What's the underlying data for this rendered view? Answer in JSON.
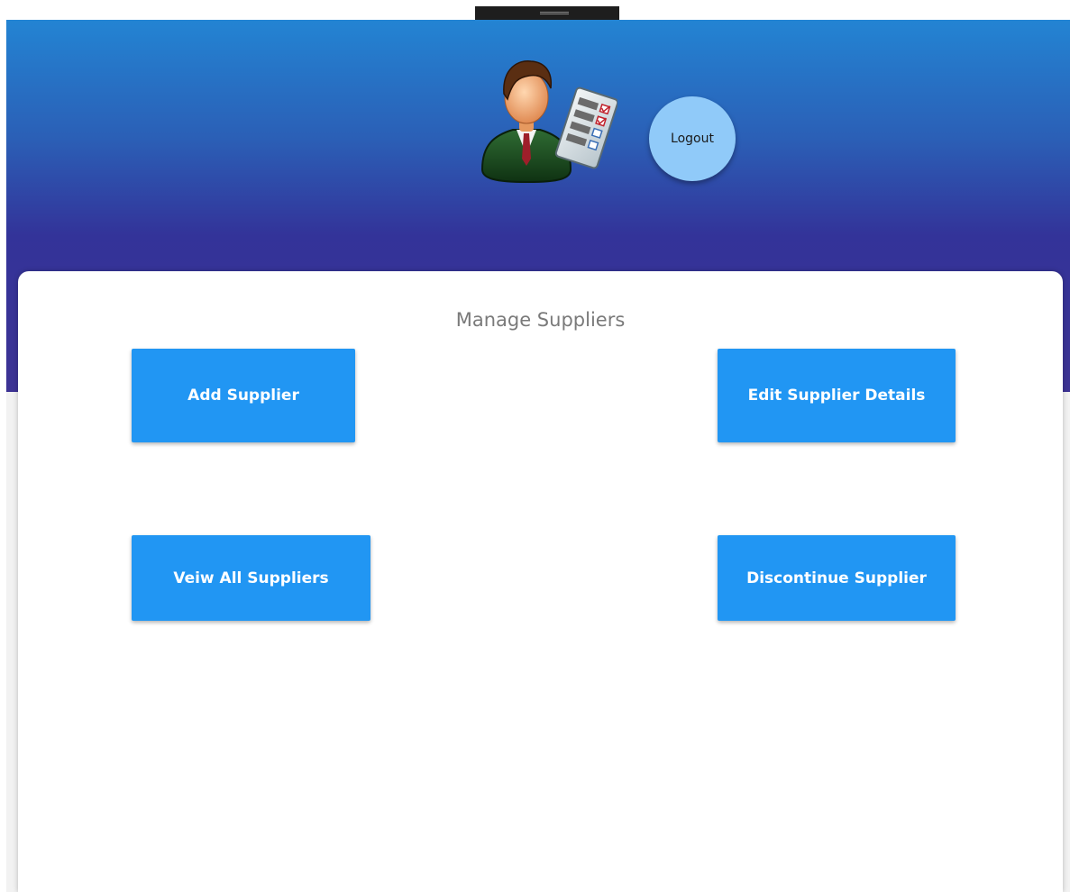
{
  "header": {
    "logout_label": "Logout"
  },
  "main": {
    "title": "Manage Suppliers",
    "buttons": {
      "add": "Add Supplier",
      "edit": "Edit Supplier Details",
      "view": "Veiw All Suppliers",
      "discontinue": "Discontinue Supplier"
    }
  },
  "colors": {
    "header_top": "#2384d3",
    "header_bottom": "#3d3394",
    "button": "#2196f3",
    "logout": "#90caf9"
  },
  "icons": {
    "avatar": "manager-avatar-icon",
    "grip": "drag-handle-grip-icon"
  }
}
